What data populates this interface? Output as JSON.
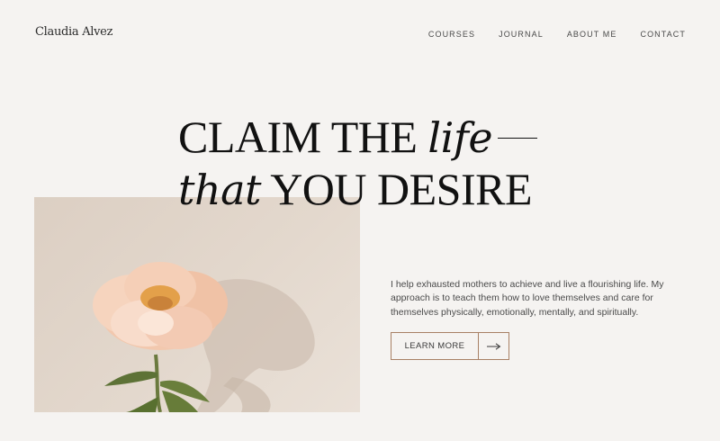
{
  "brand": {
    "name": "Claudia Alvez"
  },
  "nav": {
    "items": [
      "COURSES",
      "JOURNAL",
      "ABOUT ME",
      "CONTACT"
    ]
  },
  "hero": {
    "line1_caps": "CLAIM THE",
    "line1_italic": "life",
    "line2_italic": "that",
    "line2_caps": "YOU DESIRE",
    "intro": "I help exhausted mothers to achieve and live a flourishing life. My approach is to teach them how to love themselves and care for themselves physically, emotionally, mentally, and spiritually.",
    "cta_label": "LEARN MORE"
  },
  "colors": {
    "background": "#f5f3f1",
    "accent": "#a88064",
    "text": "#111111"
  },
  "icons": {
    "cta": "arrow-right-icon",
    "image": "peony-flower-photo"
  }
}
